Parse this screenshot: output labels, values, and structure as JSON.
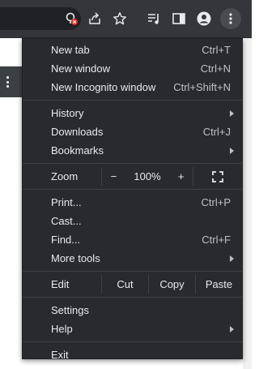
{
  "toolbar": {
    "icons": [
      "tracking-blocked-icon",
      "share-icon",
      "bookmark-star-icon",
      "media-playlist-icon",
      "side-panel-icon",
      "profile-icon",
      "chrome-menu-icon"
    ]
  },
  "menu": {
    "group1": [
      {
        "label": "New tab",
        "shortcut": "Ctrl+T"
      },
      {
        "label": "New window",
        "shortcut": "Ctrl+N"
      },
      {
        "label": "New Incognito window",
        "shortcut": "Ctrl+Shift+N"
      }
    ],
    "group2": [
      {
        "label": "History",
        "submenu": true
      },
      {
        "label": "Downloads",
        "shortcut": "Ctrl+J"
      },
      {
        "label": "Bookmarks",
        "submenu": true
      }
    ],
    "zoom": {
      "label": "Zoom",
      "minus": "−",
      "value": "100%",
      "plus": "+"
    },
    "group3": [
      {
        "label": "Print...",
        "shortcut": "Ctrl+P"
      },
      {
        "label": "Cast..."
      },
      {
        "label": "Find...",
        "shortcut": "Ctrl+F"
      },
      {
        "label": "More tools",
        "submenu": true
      }
    ],
    "edit": {
      "label": "Edit",
      "cut": "Cut",
      "copy": "Copy",
      "paste": "Paste"
    },
    "group4": [
      {
        "label": "Settings"
      },
      {
        "label": "Help",
        "submenu": true
      }
    ],
    "exit": {
      "label": "Exit"
    }
  },
  "colors": {
    "menu_bg": "#292a2d",
    "toolbar_bg": "#35363a",
    "text": "#e8eaed",
    "shortcut": "#bdc1c6"
  }
}
